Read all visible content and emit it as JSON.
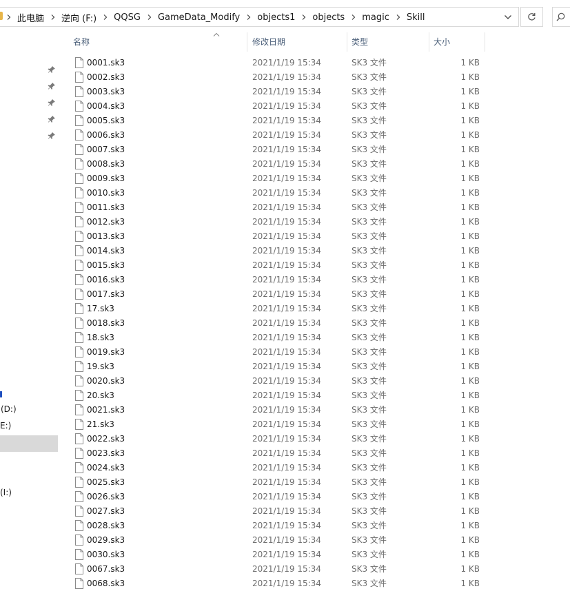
{
  "address_bar": {
    "crumbs": [
      "此电脑",
      "逆向 (F:)",
      "QQSG",
      "GameData_Modify",
      "objects1",
      "objects",
      "magic",
      "Skill"
    ]
  },
  "columns": {
    "name": "名称",
    "date": "修改日期",
    "type": "类型",
    "size": "大小"
  },
  "nav": {
    "items": [
      "(D:)",
      "E:)",
      "(I:)"
    ]
  },
  "files": [
    {
      "name": "0001.sk3",
      "date": "2021/1/19 15:34",
      "type": "SK3 文件",
      "size": "1 KB"
    },
    {
      "name": "0002.sk3",
      "date": "2021/1/19 15:34",
      "type": "SK3 文件",
      "size": "1 KB"
    },
    {
      "name": "0003.sk3",
      "date": "2021/1/19 15:34",
      "type": "SK3 文件",
      "size": "1 KB"
    },
    {
      "name": "0004.sk3",
      "date": "2021/1/19 15:34",
      "type": "SK3 文件",
      "size": "1 KB"
    },
    {
      "name": "0005.sk3",
      "date": "2021/1/19 15:34",
      "type": "SK3 文件",
      "size": "1 KB"
    },
    {
      "name": "0006.sk3",
      "date": "2021/1/19 15:34",
      "type": "SK3 文件",
      "size": "1 KB"
    },
    {
      "name": "0007.sk3",
      "date": "2021/1/19 15:34",
      "type": "SK3 文件",
      "size": "1 KB"
    },
    {
      "name": "0008.sk3",
      "date": "2021/1/19 15:34",
      "type": "SK3 文件",
      "size": "1 KB"
    },
    {
      "name": "0009.sk3",
      "date": "2021/1/19 15:34",
      "type": "SK3 文件",
      "size": "1 KB"
    },
    {
      "name": "0010.sk3",
      "date": "2021/1/19 15:34",
      "type": "SK3 文件",
      "size": "1 KB"
    },
    {
      "name": "0011.sk3",
      "date": "2021/1/19 15:34",
      "type": "SK3 文件",
      "size": "1 KB"
    },
    {
      "name": "0012.sk3",
      "date": "2021/1/19 15:34",
      "type": "SK3 文件",
      "size": "1 KB"
    },
    {
      "name": "0013.sk3",
      "date": "2021/1/19 15:34",
      "type": "SK3 文件",
      "size": "1 KB"
    },
    {
      "name": "0014.sk3",
      "date": "2021/1/19 15:34",
      "type": "SK3 文件",
      "size": "1 KB"
    },
    {
      "name": "0015.sk3",
      "date": "2021/1/19 15:34",
      "type": "SK3 文件",
      "size": "1 KB"
    },
    {
      "name": "0016.sk3",
      "date": "2021/1/19 15:34",
      "type": "SK3 文件",
      "size": "1 KB"
    },
    {
      "name": "0017.sk3",
      "date": "2021/1/19 15:34",
      "type": "SK3 文件",
      "size": "1 KB"
    },
    {
      "name": "17.sk3",
      "date": "2021/1/19 15:34",
      "type": "SK3 文件",
      "size": "1 KB"
    },
    {
      "name": "0018.sk3",
      "date": "2021/1/19 15:34",
      "type": "SK3 文件",
      "size": "1 KB"
    },
    {
      "name": "18.sk3",
      "date": "2021/1/19 15:34",
      "type": "SK3 文件",
      "size": "1 KB"
    },
    {
      "name": "0019.sk3",
      "date": "2021/1/19 15:34",
      "type": "SK3 文件",
      "size": "1 KB"
    },
    {
      "name": "19.sk3",
      "date": "2021/1/19 15:34",
      "type": "SK3 文件",
      "size": "1 KB"
    },
    {
      "name": "0020.sk3",
      "date": "2021/1/19 15:34",
      "type": "SK3 文件",
      "size": "1 KB"
    },
    {
      "name": "20.sk3",
      "date": "2021/1/19 15:34",
      "type": "SK3 文件",
      "size": "1 KB"
    },
    {
      "name": "0021.sk3",
      "date": "2021/1/19 15:34",
      "type": "SK3 文件",
      "size": "1 KB"
    },
    {
      "name": "21.sk3",
      "date": "2021/1/19 15:34",
      "type": "SK3 文件",
      "size": "1 KB"
    },
    {
      "name": "0022.sk3",
      "date": "2021/1/19 15:34",
      "type": "SK3 文件",
      "size": "1 KB"
    },
    {
      "name": "0023.sk3",
      "date": "2021/1/19 15:34",
      "type": "SK3 文件",
      "size": "1 KB"
    },
    {
      "name": "0024.sk3",
      "date": "2021/1/19 15:34",
      "type": "SK3 文件",
      "size": "1 KB"
    },
    {
      "name": "0025.sk3",
      "date": "2021/1/19 15:34",
      "type": "SK3 文件",
      "size": "1 KB"
    },
    {
      "name": "0026.sk3",
      "date": "2021/1/19 15:34",
      "type": "SK3 文件",
      "size": "1 KB"
    },
    {
      "name": "0027.sk3",
      "date": "2021/1/19 15:34",
      "type": "SK3 文件",
      "size": "1 KB"
    },
    {
      "name": "0028.sk3",
      "date": "2021/1/19 15:34",
      "type": "SK3 文件",
      "size": "1 KB"
    },
    {
      "name": "0029.sk3",
      "date": "2021/1/19 15:34",
      "type": "SK3 文件",
      "size": "1 KB"
    },
    {
      "name": "0030.sk3",
      "date": "2021/1/19 15:34",
      "type": "SK3 文件",
      "size": "1 KB"
    },
    {
      "name": "0067.sk3",
      "date": "2021/1/19 15:34",
      "type": "SK3 文件",
      "size": "1 KB"
    },
    {
      "name": "0068.sk3",
      "date": "2021/1/19 15:34",
      "type": "SK3 文件",
      "size": "1 KB"
    }
  ]
}
